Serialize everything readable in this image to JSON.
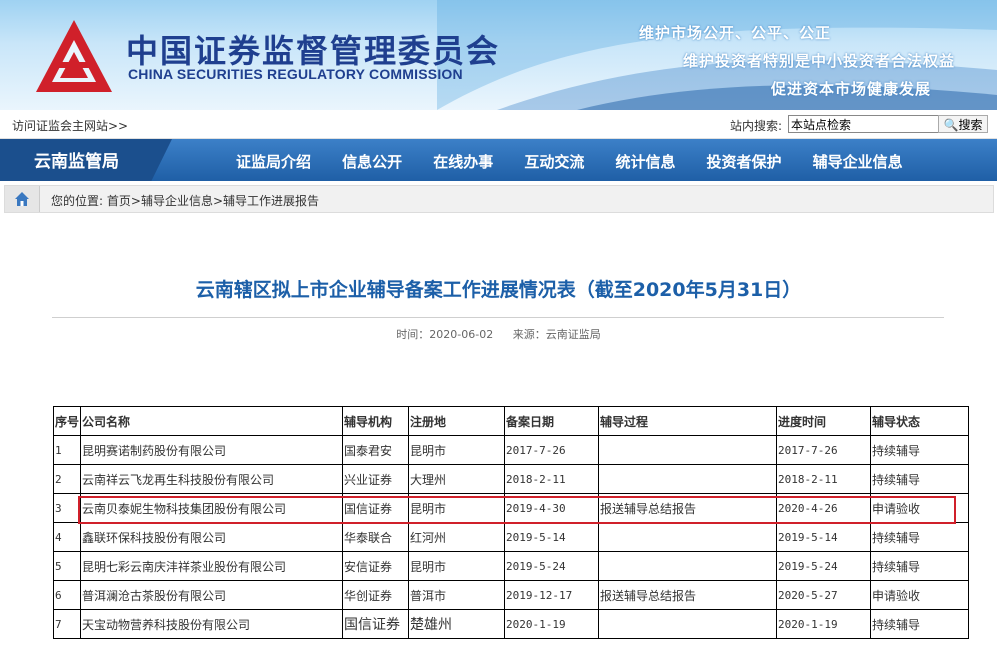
{
  "header": {
    "cn_title": "中国证券监督管理委员会",
    "en_title": "CHINA SECURITIES REGULATORY COMMISSION",
    "slogans": [
      "维护市场公开、公平、公正",
      "维护投资者特别是中小投资者合法权益",
      "促进资本市场健康发展"
    ],
    "brand_color": "#1f3f8f",
    "logo_color": "#d0202a"
  },
  "utilbar": {
    "visit_link": "访问证监会主网站>>",
    "search_label": "站内搜索:",
    "search_value": "本站点检索",
    "search_button": "搜索"
  },
  "nav": {
    "bureau": "云南监管局",
    "items": [
      "证监局介绍",
      "信息公开",
      "在线办事",
      "互动交流",
      "统计信息",
      "投资者保护",
      "辅导企业信息"
    ]
  },
  "breadcrumb": {
    "label": "您的位置:",
    "items": [
      "首页",
      "辅导企业信息",
      "辅导工作进展报告"
    ],
    "separator": ">"
  },
  "article": {
    "title": "云南辖区拟上市企业辅导备案工作进展情况表（截至2020年5月31日）",
    "time": "时间：2020-06-02",
    "source": "来源：云南证监局"
  },
  "table": {
    "headers": [
      "序号",
      "公司名称",
      "辅导机构",
      "注册地",
      "备案日期",
      "辅导过程",
      "进度时间",
      "辅导状态"
    ],
    "rows": [
      [
        "1",
        "昆明赛诺制药股份有限公司",
        "国泰君安",
        "昆明市",
        "2017-7-26",
        "",
        "2017-7-26",
        "持续辅导"
      ],
      [
        "2",
        "云南祥云飞龙再生科技股份有限公司",
        "兴业证券",
        "大理州",
        "2018-2-11",
        "",
        "2018-2-11",
        "持续辅导"
      ],
      [
        "3",
        "云南贝泰妮生物科技集团股份有限公司",
        "国信证券",
        "昆明市",
        "2019-4-30",
        "报送辅导总结报告",
        "2020-4-26",
        "申请验收"
      ],
      [
        "4",
        "鑫联环保科技股份有限公司",
        "华泰联合",
        "红河州",
        "2019-5-14",
        "",
        "2019-5-14",
        "持续辅导"
      ],
      [
        "5",
        "昆明七彩云南庆沣祥茶业股份有限公司",
        "安信证券",
        "昆明市",
        "2019-5-24",
        "",
        "2019-5-24",
        "持续辅导"
      ],
      [
        "6",
        "普洱澜沧古茶股份有限公司",
        "华创证券",
        "普洱市",
        "2019-12-17",
        "报送辅导总结报告",
        "2020-5-27",
        "申请验收"
      ],
      [
        "7",
        "天宝动物营养科技股份有限公司",
        "国信证券",
        "楚雄州",
        "2020-1-19",
        "",
        "2020-1-19",
        "持续辅导"
      ]
    ],
    "highlight_color": "#d0202a"
  }
}
